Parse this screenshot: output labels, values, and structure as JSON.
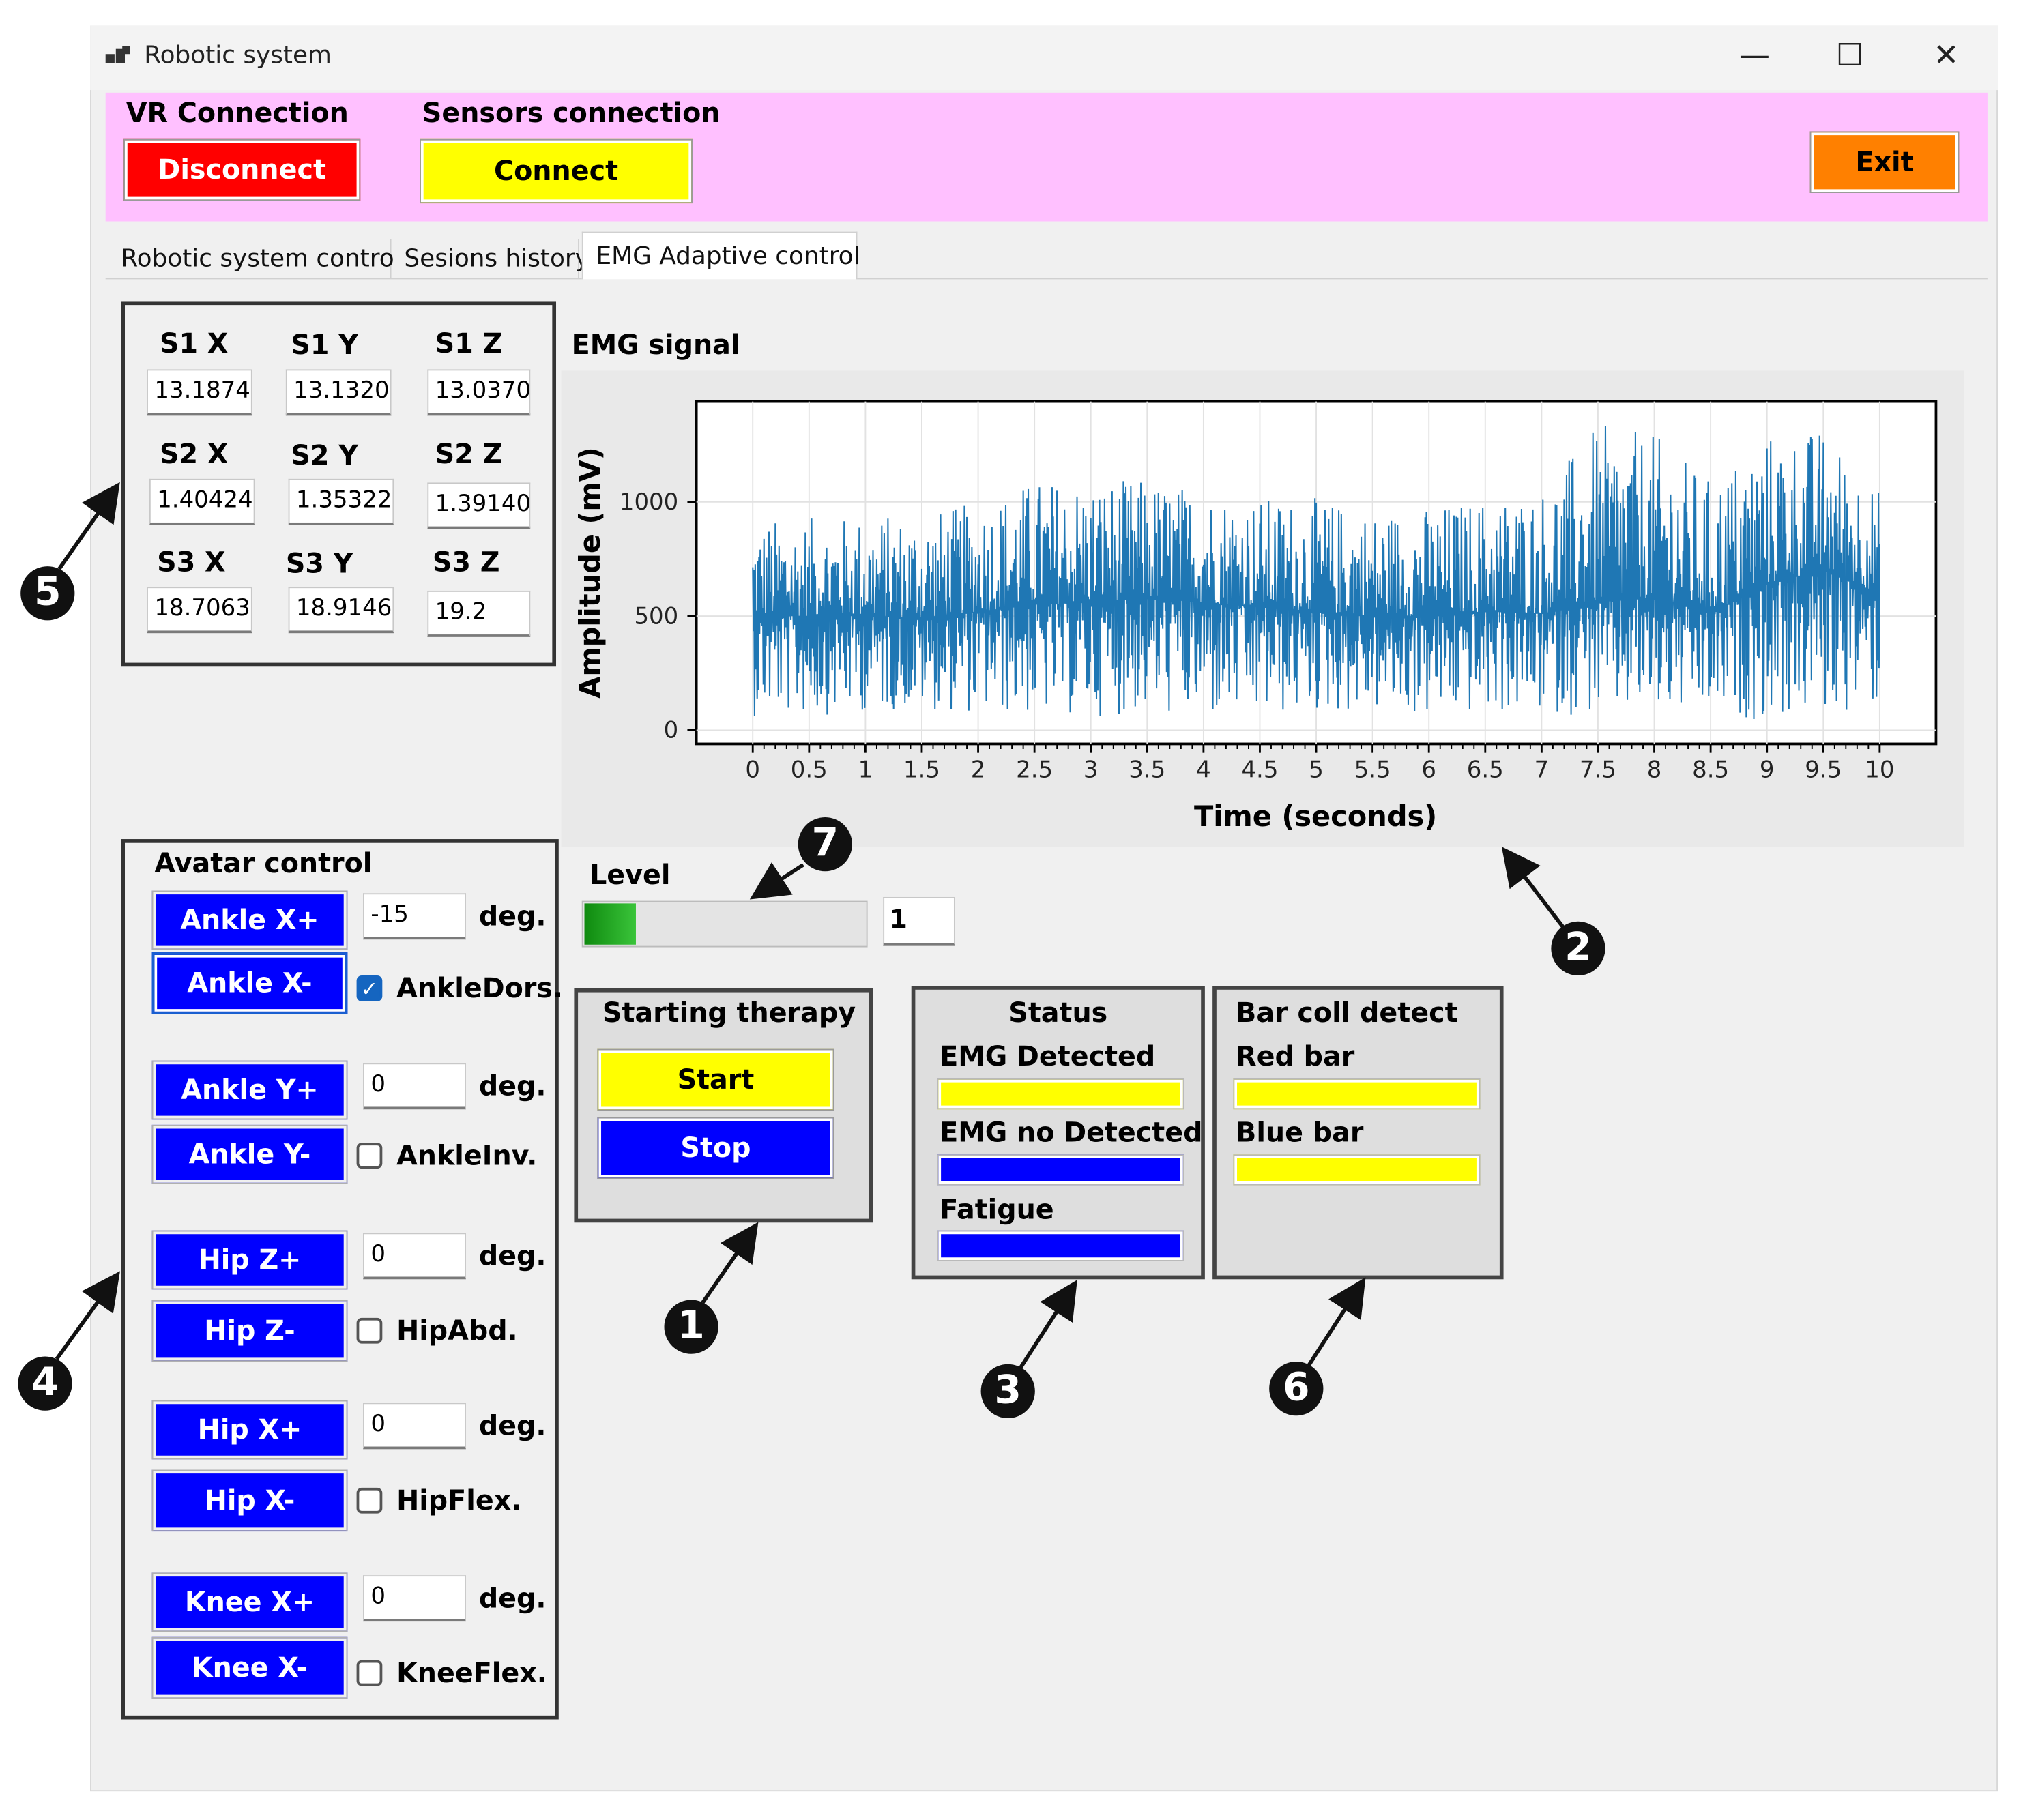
{
  "window": {
    "title": "Robotic system",
    "minimize": "—",
    "maximize": "☐",
    "close": "✕"
  },
  "connection": {
    "vr_label": "VR Connection",
    "vr_button": "Disconnect",
    "sensors_label": "Sensors connection",
    "sensors_button": "Connect",
    "exit_button": "Exit"
  },
  "tabs": [
    {
      "label": "Robotic system control"
    },
    {
      "label": "Sesions history"
    },
    {
      "label": "EMG Adaptive control"
    }
  ],
  "sensors": {
    "s1x_label": "S1 X",
    "s1x": "13.1874",
    "s1y_label": "S1 Y",
    "s1y": "13.13204",
    "s1z_label": "S1 Z",
    "s1z": "13.03709",
    "s2x_label": "S2 X",
    "s2x": "1.404242",
    "s2y_label": "S2 Y",
    "s2y": "1.353223",
    "s2z_label": "S2 Z",
    "s2z": "1.391402",
    "s3x_label": "S3 X",
    "s3x": "18.70631",
    "s3y_label": "S3 Y",
    "s3y": "18.91468",
    "s3z_label": "S3 Z",
    "s3z": "19.2"
  },
  "emg": {
    "label": "EMG signal"
  },
  "chart_data": {
    "type": "line",
    "title": "",
    "xlabel": "Time (seconds)",
    "ylabel": "Amplitude (mV)",
    "xlim": [
      -0.5,
      10.5
    ],
    "ylim": [
      -60,
      1440
    ],
    "xticks": [
      "0",
      "0.5",
      "1",
      "1.5",
      "2",
      "2.5",
      "3",
      "3.5",
      "4",
      "4.5",
      "5",
      "5.5",
      "6",
      "6.5",
      "7",
      "7.5",
      "8",
      "8.5",
      "9",
      "9.5",
      "10"
    ],
    "yticks": [
      "0",
      "500",
      "1000"
    ],
    "grid": true,
    "line_color": "#1f77b4",
    "series": [
      {
        "name": "",
        "x": [
          0,
          0.5,
          1,
          1.5,
          2,
          2.5,
          3,
          3.5,
          4,
          4.5,
          5,
          5.5,
          6,
          6.5,
          7,
          7.5,
          8,
          8.5,
          9,
          9.5,
          10
        ],
        "mean": [
          500,
          500,
          500,
          490,
          520,
          550,
          560,
          580,
          560,
          540,
          520,
          500,
          500,
          520,
          510,
          560,
          580,
          510,
          640,
          700,
          600
        ],
        "min": [
          60,
          60,
          80,
          90,
          70,
          60,
          60,
          70,
          40,
          50,
          70,
          80,
          50,
          70,
          70,
          60,
          60,
          60,
          40,
          60,
          100
        ],
        "max": [
          920,
          930,
          940,
          950,
          1000,
          1100,
          1100,
          1100,
          1060,
          1020,
          1020,
          960,
          980,
          1020,
          1060,
          1340,
          1300,
          1100,
          1300,
          1320,
          1050
        ]
      }
    ]
  },
  "level": {
    "label": "Level",
    "value": "1",
    "fill_fraction": 0.18
  },
  "therapy": {
    "title": "Starting therapy",
    "start": "Start",
    "stop": "Stop"
  },
  "status": {
    "title": "Status",
    "emg_detected": "EMG Detected",
    "emg_detected_color": "#ffff00",
    "emg_no_detected": "EMG no Detected",
    "emg_no_detected_color": "#0000ff",
    "fatigue": "Fatigue",
    "fatigue_color": "#0000ff"
  },
  "barcoll": {
    "title": "Bar coll detect",
    "red_bar": "Red bar",
    "red_bar_color": "#ffff00",
    "blue_bar": "Blue bar",
    "blue_bar_color": "#ffff00"
  },
  "avatar": {
    "title": "Avatar control",
    "deg": "deg.",
    "ankle_x_plus": "Ankle X+",
    "ankle_x_minus": "Ankle X-",
    "ankle_x_value": "-15",
    "ankle_dors": "AnkleDors.",
    "ankle_dors_checked": true,
    "ankle_y_plus": "Ankle Y+",
    "ankle_y_minus": "Ankle Y-",
    "ankle_y_value": "0",
    "ankle_inv": "AnkleInv.",
    "ankle_inv_checked": false,
    "hip_z_plus": "Hip Z+",
    "hip_z_minus": "Hip Z-",
    "hip_z_value": "0",
    "hip_abd": "HipAbd.",
    "hip_abd_checked": false,
    "hip_x_plus": "Hip X+",
    "hip_x_minus": "Hip X-",
    "hip_x_value": "0",
    "hip_flex": "HipFlex.",
    "hip_flex_checked": false,
    "knee_x_plus": "Knee X+",
    "knee_x_minus": "Knee X-",
    "knee_x_value": "0",
    "knee_flex": "KneeFlex.",
    "knee_flex_checked": false
  },
  "callouts": [
    "1",
    "2",
    "3",
    "4",
    "5",
    "6",
    "7"
  ]
}
